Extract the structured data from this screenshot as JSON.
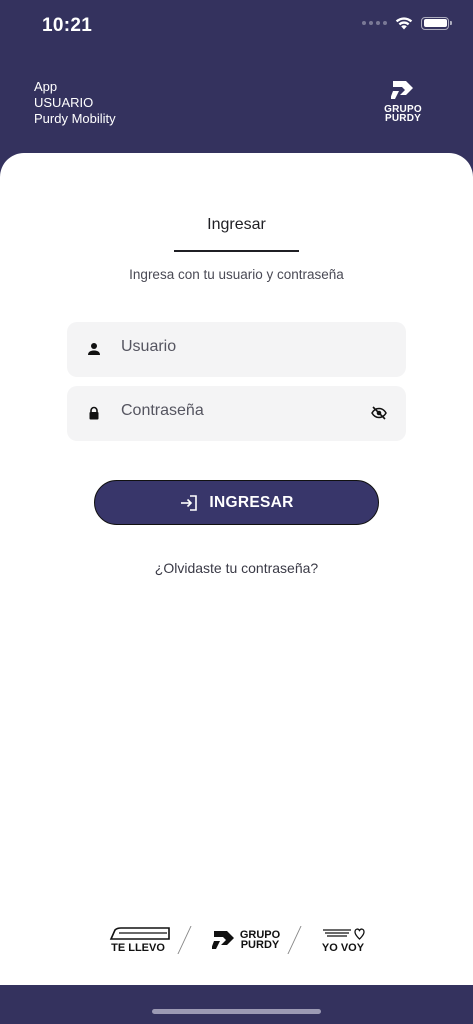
{
  "status_bar": {
    "time": "10:21"
  },
  "header": {
    "lines": [
      "App",
      "USUARIO",
      "Purdy Mobility"
    ],
    "logo_line1": "GRUPO",
    "logo_line2": "PURDY"
  },
  "login": {
    "title": "Ingresar",
    "subtitle": "Ingresa con tu usuario y contraseña",
    "username_placeholder": "Usuario",
    "password_placeholder": "Contraseña",
    "submit_label": "INGRESAR",
    "forgot_label": "¿Olvidaste tu contraseña?"
  },
  "footer": {
    "partner1": "TE LLEVO",
    "partner2_line1": "GRUPO",
    "partner2_line2": "PURDY",
    "partner3": "YO VOY"
  },
  "icons": {
    "wifi": "wifi-icon",
    "battery": "battery-icon",
    "user": "person-icon",
    "lock": "lock-icon",
    "eye": "eye-off-icon",
    "login": "login-icon"
  },
  "colors": {
    "primary": "#34325e",
    "button": "#38366a"
  }
}
